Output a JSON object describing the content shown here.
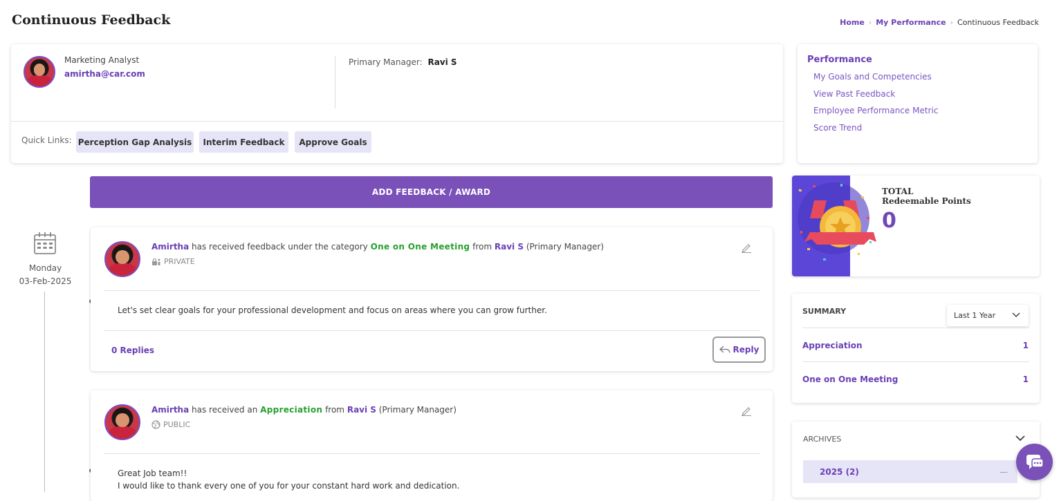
{
  "page": {
    "title": "Continuous Feedback"
  },
  "breadcrumb": {
    "home": "Home",
    "section": "My Performance",
    "current": "Continuous Feedback"
  },
  "profile": {
    "role": "Marketing Analyst",
    "email": "amirtha@car.com",
    "manager_label": "Primary Manager:",
    "manager_name": "Ravi S"
  },
  "quick_links": {
    "label": "Quick Links:",
    "items": [
      "Perception Gap Analysis",
      "Interim Feedback",
      "Approve Goals"
    ]
  },
  "performance": {
    "title": "Performance",
    "links": [
      "My Goals and Competencies",
      "View Past Feedback",
      "Employee Performance Metric",
      "Score Trend"
    ]
  },
  "add_button": "ADD FEEDBACK / AWARD",
  "timeline": {
    "day": "Monday",
    "date": "03-Feb-2025"
  },
  "feedback": [
    {
      "name": "Amirtha",
      "text1": "has received feedback under the category",
      "category": "One on One Meeting",
      "text2": "from",
      "from": "Ravi S",
      "role": "(Primary Manager)",
      "visibility": "PRIVATE",
      "message": "Let's set clear goals for your professional development and focus on areas where you can grow further.",
      "replies": "0 Replies",
      "reply_label": "Reply"
    },
    {
      "name": "Amirtha",
      "text1": "has received an",
      "category": "Appreciation",
      "text2": "from",
      "from": "Ravi S",
      "role": "(Primary Manager)",
      "visibility": "PUBLIC",
      "message": "Great Job team!!",
      "message2": "I would like to thank every one of you for your constant hard work and dedication."
    }
  ],
  "points": {
    "total_label": "TOTAL",
    "sub_label": "Redeemable Points",
    "value": "0"
  },
  "summary": {
    "title": "SUMMARY",
    "period": "Last 1 Year",
    "rows": [
      {
        "label": "Appreciation",
        "count": "1"
      },
      {
        "label": "One on One Meeting",
        "count": "1"
      }
    ]
  },
  "archives": {
    "title": "ARCHIVES",
    "year": "2025 (2)"
  },
  "colors": {
    "accent": "#7a50b9",
    "link": "#6a3fb5",
    "category": "#27a02f",
    "chip": "#e6e4f7"
  }
}
